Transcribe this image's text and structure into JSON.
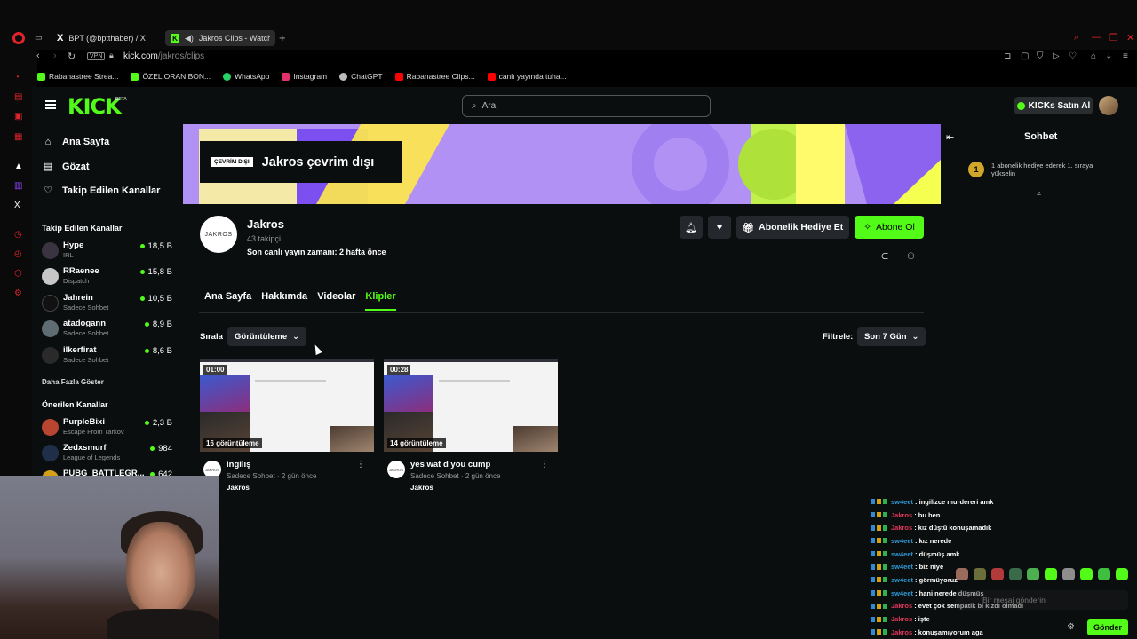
{
  "browser": {
    "tabs": [
      {
        "label": "BPT (@bptthaber) / X"
      },
      {
        "label": "Jakros Clips - Watch"
      }
    ],
    "url_host": "kick.com",
    "url_path": "/jakros/clips",
    "vpn_label": "VPN",
    "bookmarks": [
      {
        "label": "Rabanastree Strea...",
        "color": "#53fc18"
      },
      {
        "label": "ÖZEL ORAN BON...",
        "color": "#53fc18"
      },
      {
        "label": "WhatsApp",
        "color": "#25d366"
      },
      {
        "label": "Instagram",
        "color": "#e1306c"
      },
      {
        "label": "ChatGPT",
        "color": "#bbbbbb"
      },
      {
        "label": "Rabanastree Clips...",
        "color": "#ff0000"
      },
      {
        "label": "canlı yayında tuha...",
        "color": "#ff0000"
      }
    ]
  },
  "site": {
    "logo": "KICK",
    "logo_beta": "BETA",
    "search_placeholder": "Ara",
    "kicks_button": "KICKs Satın Al",
    "accent": "#53fc18"
  },
  "sidebar": {
    "main": [
      {
        "label": "Ana Sayfa",
        "icon": "home-icon"
      },
      {
        "label": "Gözat",
        "icon": "browse-icon"
      },
      {
        "label": "Takip Edilen Kanallar",
        "icon": "heart-icon"
      }
    ],
    "followed_heading": "Takip Edilen Kanallar",
    "followed": [
      {
        "name": "Hype",
        "category": "IRL",
        "viewers": "18,5 B"
      },
      {
        "name": "RRaenee",
        "category": "Dispatch",
        "viewers": "15,8 B"
      },
      {
        "name": "Jahrein",
        "category": "Sadece Sohbet",
        "viewers": "10,5 B"
      },
      {
        "name": "atadogann",
        "category": "Sadece Sohbet",
        "viewers": "8,9 B"
      },
      {
        "name": "ilkerfirat",
        "category": "Sadece Sohbet",
        "viewers": "8,6 B"
      }
    ],
    "show_more": "Daha Fazla Göster",
    "recommended_heading": "Önerilen Kanallar",
    "recommended": [
      {
        "name": "PurpleBixi",
        "category": "Escape From Tarkov",
        "viewers": "2,3 B"
      },
      {
        "name": "Zedxsmurf",
        "category": "League of Legends",
        "viewers": "984"
      },
      {
        "name": "PUBG_BATTLEGR...",
        "category": "",
        "viewers": "642"
      }
    ]
  },
  "channel": {
    "offline_badge": "ÇEVRİM DIŞI",
    "offline_text": "Jakros çevrim dışı",
    "avatar_text": "JAKROS",
    "name": "Jakros",
    "followers": "43 takipçi",
    "last_live": "Son canlı yayın zamanı: 2 hafta önce",
    "gift_button": "Abonelik Hediye Et",
    "subscribe_button": "Abone Ol",
    "tabs": [
      "Ana Sayfa",
      "Hakkımda",
      "Videolar",
      "Klipler"
    ],
    "active_tab": "Klipler",
    "sort_label": "Sırala",
    "sort_value": "Görüntüleme",
    "filter_label": "Filtrele:",
    "filter_value": "Son 7 Gün"
  },
  "clips": [
    {
      "duration": "01:00",
      "views": "16 görüntüleme",
      "title": "ingilış",
      "meta": "Sadece Sohbet · 2 gün önce",
      "author": "Jakros"
    },
    {
      "duration": "00:28",
      "views": "14 görüntüleme",
      "title": "yes wat d you cump",
      "meta": "Sadece Sohbet · 2 gün önce",
      "author": "Jakros"
    }
  ],
  "chat": {
    "title": "Sohbet",
    "gift_rank": "1",
    "gift_text": "1 abonelik hediye ederek 1. sıraya yükselin",
    "messages": [
      {
        "user": "sw4eet",
        "text": ": ingilizce murdereri amk",
        "color": "#2f9bd6"
      },
      {
        "user": "Jakros",
        "text": ": bu ben",
        "color": "#e0375c"
      },
      {
        "user": "Jakros",
        "text": ": kız düştü konuşamadık",
        "color": "#e0375c"
      },
      {
        "user": "sw4eet",
        "text": ": kız nerede",
        "color": "#2f9bd6"
      },
      {
        "user": "sw4eet",
        "text": ": düşmüş amk",
        "color": "#2f9bd6"
      },
      {
        "user": "sw4eet",
        "text": ": biz niye",
        "color": "#2f9bd6"
      },
      {
        "user": "sw4eet",
        "text": ": görmüyoruz",
        "color": "#2f9bd6"
      },
      {
        "user": "sw4eet",
        "text": ": hani nerede düşmüş",
        "color": "#2f9bd6"
      },
      {
        "user": "Jakros",
        "text": ": evet çok sempatik bi kızdı olmadı",
        "color": "#e0375c"
      },
      {
        "user": "Jakros",
        "text": ": işte",
        "color": "#e0375c"
      },
      {
        "user": "Jakros",
        "text": ": konuşamıyorum aga",
        "color": "#e0375c"
      }
    ],
    "input_placeholder": "Bir mesaj gönderin",
    "send_button": "Gönder"
  }
}
